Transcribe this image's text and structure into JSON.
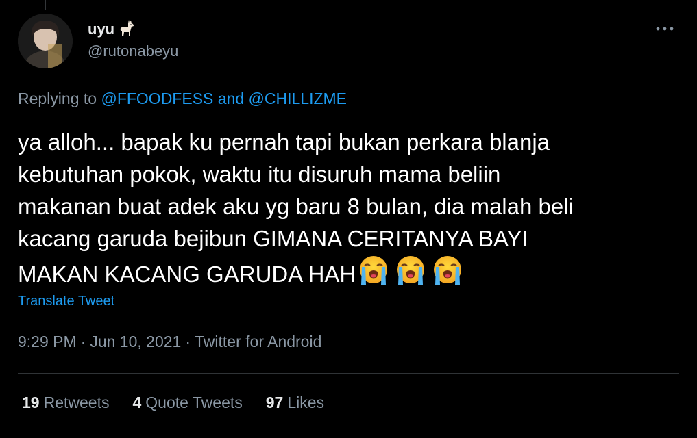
{
  "tweet": {
    "author": {
      "display_name": "uyu",
      "display_name_emoji": "llama-icon",
      "handle": "@rutonabeyu"
    },
    "replying_to": {
      "prefix": "Replying to",
      "mentions": [
        "@FFOODFESS",
        "@CHILLIZME"
      ],
      "conjunction": "and"
    },
    "text": "ya alloh... bapak ku pernah tapi bukan perkara blanja\nkebutuhan pokok, waktu itu disuruh mama beliin\nmakanan buat adek aku yg baru 8 bulan, dia malah beli\nkacang garuda bejibun GIMANA CERITANYA BAYI\nMAKAN KACANG GARUDA HAH",
    "emojis": [
      "loudly-crying-face-icon",
      "loudly-crying-face-icon",
      "loudly-crying-face-icon"
    ],
    "translate_label": "Translate Tweet",
    "time": "9:29 PM",
    "date": "Jun 10, 2021",
    "source": "Twitter for Android",
    "separator": "·",
    "stats": {
      "retweets": {
        "count": "19",
        "label": "Retweets"
      },
      "quotes": {
        "count": "4",
        "label": "Quote Tweets"
      },
      "likes": {
        "count": "97",
        "label": "Likes"
      }
    }
  },
  "colors": {
    "background": "#000000",
    "primary_text": "#ffffff",
    "secondary_text": "#8b98a5",
    "accent": "#1d9bf0",
    "divider": "#2f3336"
  }
}
